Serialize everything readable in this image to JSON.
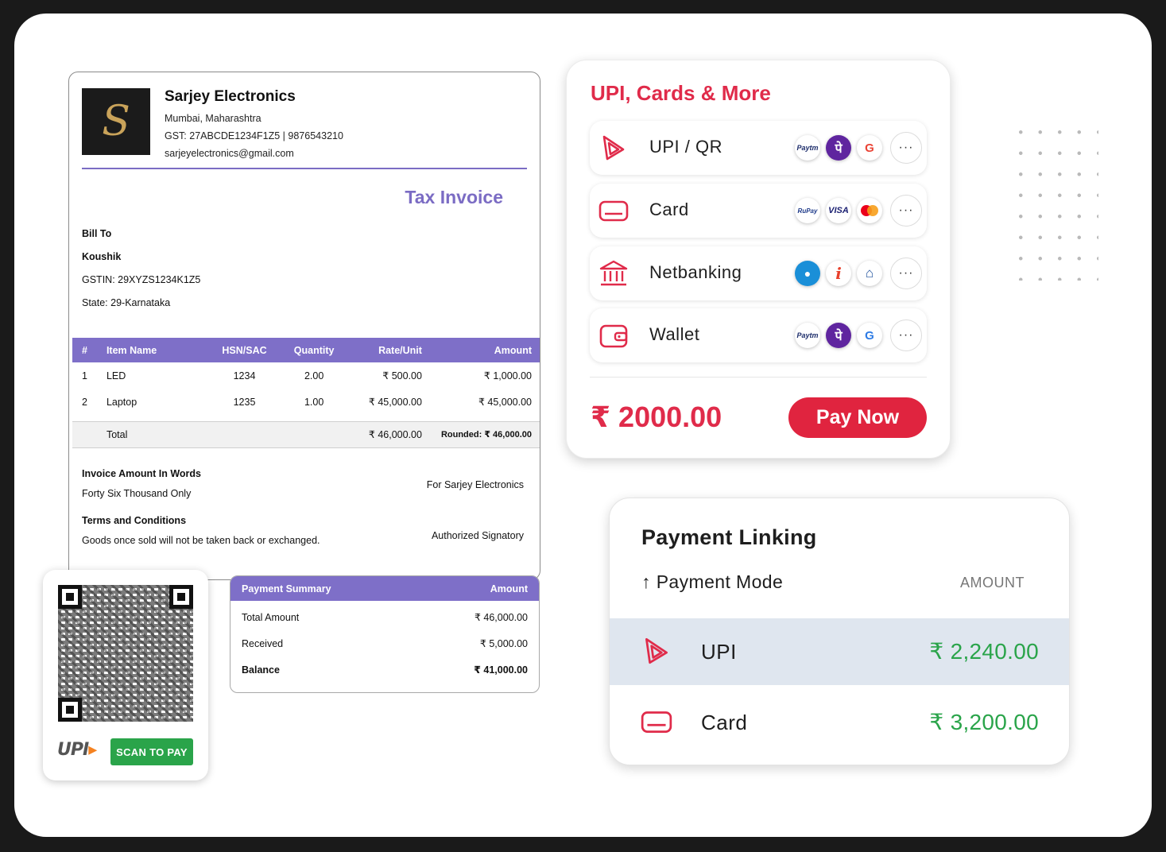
{
  "invoice": {
    "logo_letter": "S",
    "company": {
      "name": "Sarjey Electronics",
      "address": "Mumbai, Maharashtra",
      "gst_phone": "GST: 27ABCDE1234F1Z5  |  9876543210",
      "email": "sarjeyelectronics@gmail.com"
    },
    "title": "Tax Invoice",
    "bill_to": {
      "heading": "Bill To",
      "name": "Koushik",
      "gstin": "GSTIN: 29XYZS1234K1Z5",
      "state": "State: 29-Karnataka"
    },
    "columns": [
      "#",
      "Item Name",
      "HSN/SAC",
      "Quantity",
      "Rate/Unit",
      "Amount"
    ],
    "items": [
      {
        "no": "1",
        "name": "LED",
        "hsn": "1234",
        "qty": "2.00",
        "rate": "₹ 500.00",
        "amount": "₹ 1,000.00"
      },
      {
        "no": "2",
        "name": "Laptop",
        "hsn": "1235",
        "qty": "1.00",
        "rate": "₹ 45,000.00",
        "amount": "₹ 45,000.00"
      }
    ],
    "total": {
      "label": "Total",
      "value": "₹ 46,000.00",
      "rounded_label": "Rounded:",
      "rounded_value": "₹ 46,000.00"
    },
    "words_heading": "Invoice Amount In Words",
    "words": "Forty Six Thousand Only",
    "terms_heading": "Terms and Conditions",
    "terms": "Goods once sold will not be taken back or exchanged.",
    "for_company": "For Sarjey Electronics",
    "signatory": "Authorized Signatory"
  },
  "qr": {
    "upi_text": "UPI",
    "scan_label": "SCAN TO PAY"
  },
  "summary": {
    "heading": "Payment Summary",
    "amount_heading": "Amount",
    "rows": [
      {
        "label": "Total Amount",
        "value": "₹ 46,000.00"
      },
      {
        "label": "Received",
        "value": "₹ 5,000.00"
      },
      {
        "label": "Balance",
        "value": "₹ 41,000.00"
      }
    ]
  },
  "payment": {
    "title": "UPI, Cards & More",
    "options": [
      {
        "label": "UPI / QR",
        "icon": "upi-icon",
        "brands": [
          "Paytm",
          "PhonePe",
          "GPay"
        ]
      },
      {
        "label": "Card",
        "icon": "card-icon",
        "brands": [
          "RuPay",
          "VISA",
          "Mastercard"
        ]
      },
      {
        "label": "Netbanking",
        "icon": "bank-icon",
        "brands": [
          "SBI",
          "ICICI",
          "Bank"
        ]
      },
      {
        "label": "Wallet",
        "icon": "wallet-icon",
        "brands": [
          "Paytm",
          "PhonePe",
          "GPay"
        ]
      }
    ],
    "more_label": "···",
    "amount": "₹ 2000.00",
    "pay_label": "Pay Now",
    "accent": "#e02b4a"
  },
  "linking": {
    "title": "Payment Linking",
    "mode_label": "↑ Payment Mode",
    "amount_label": "AMOUNT",
    "rows": [
      {
        "label": "UPI",
        "value": "₹ 2,240.00",
        "selected": true
      },
      {
        "label": "Card",
        "value": "₹ 3,200.00",
        "selected": false
      }
    ]
  }
}
